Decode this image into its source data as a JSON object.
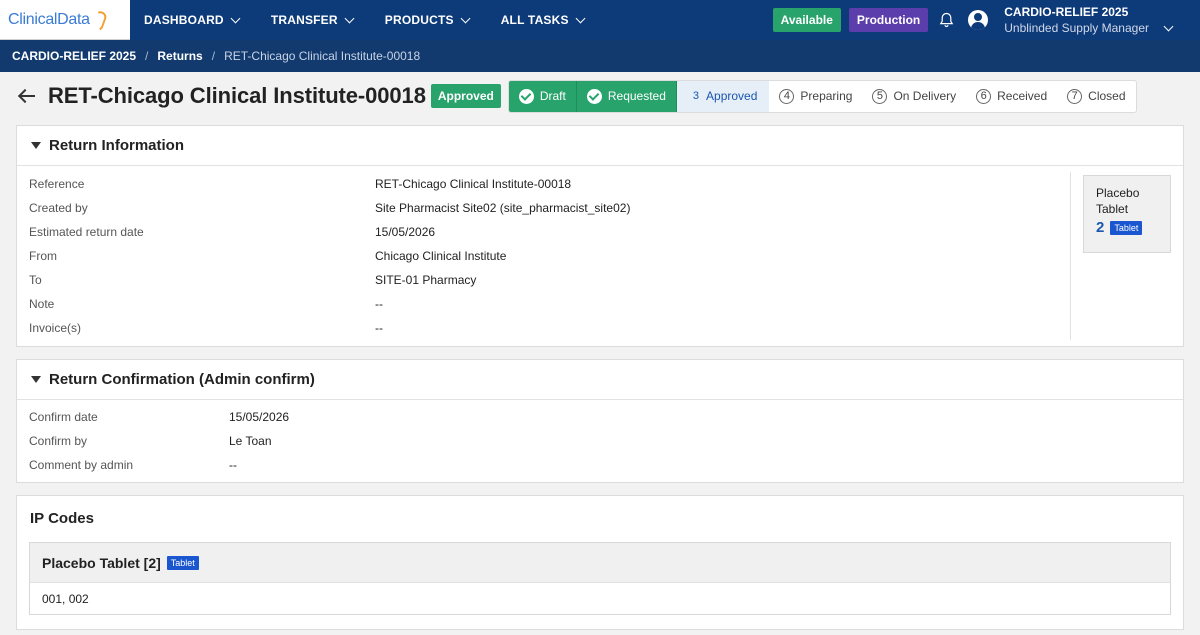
{
  "header": {
    "logo_text": "ClinicalData",
    "nav": [
      {
        "label": "DASHBOARD"
      },
      {
        "label": "TRANSFER"
      },
      {
        "label": "PRODUCTS"
      },
      {
        "label": "ALL TASKS"
      }
    ],
    "available_label": "Available",
    "production_label": "Production",
    "study": "CARDIO-RELIEF 2025",
    "role": "Unblinded Supply Manager"
  },
  "breadcrumb": {
    "study": "CARDIO-RELIEF 2025",
    "section": "Returns",
    "current": "RET-Chicago Clinical Institute-00018"
  },
  "page": {
    "title": "RET-Chicago Clinical Institute-00018",
    "status": "Approved",
    "steps": [
      {
        "num": "1",
        "label": "Draft",
        "state": "done"
      },
      {
        "num": "2",
        "label": "Requested",
        "state": "done"
      },
      {
        "num": "3",
        "label": "Approved",
        "state": "current"
      },
      {
        "num": "4",
        "label": "Preparing",
        "state": "todo"
      },
      {
        "num": "5",
        "label": "On Delivery",
        "state": "todo"
      },
      {
        "num": "6",
        "label": "Received",
        "state": "todo"
      },
      {
        "num": "7",
        "label": "Closed",
        "state": "todo"
      }
    ]
  },
  "return_info": {
    "title": "Return Information",
    "rows": [
      {
        "label": "Reference",
        "value": "RET-Chicago Clinical Institute-00018"
      },
      {
        "label": "Created by",
        "value": "Site Pharmacist Site02 (site_pharmacist_site02)"
      },
      {
        "label": "Estimated return date",
        "value": "15/05/2026"
      },
      {
        "label": "From",
        "value": "Chicago Clinical Institute"
      },
      {
        "label": "To",
        "value": "SITE-01 Pharmacy"
      },
      {
        "label": "Note",
        "value": "--"
      },
      {
        "label": "Invoice(s)",
        "value": "--"
      }
    ],
    "summary": {
      "name": "Placebo Tablet",
      "qty": "2",
      "tag": "Tablet"
    }
  },
  "return_confirm": {
    "title": "Return Confirmation (Admin confirm)",
    "rows": [
      {
        "label": "Confirm date",
        "value": "15/05/2026"
      },
      {
        "label": "Confirm by",
        "value": "Le Toan"
      },
      {
        "label": "Comment by admin",
        "value": "--"
      }
    ]
  },
  "ip_codes": {
    "title": "IP Codes",
    "group_title": "Placebo Tablet [2]",
    "group_tag": "Tablet",
    "codes": "001, 002"
  },
  "colors": {
    "nav_bg": "#0d3a78",
    "breadcrumb_bg": "#123a6e",
    "success": "#27a36b",
    "production": "#5b3dab",
    "accent": "#1a56b0"
  }
}
